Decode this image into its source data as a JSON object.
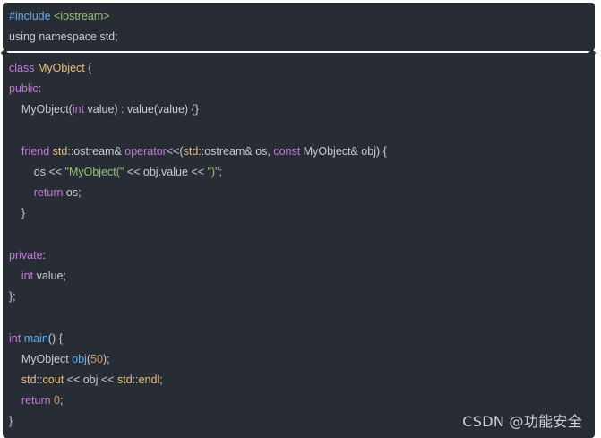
{
  "colors": {
    "background": "#282c34",
    "text": "#c7ccd6",
    "keyword": "#c678dd",
    "type": "#e5c07b",
    "function": "#61afef",
    "string": "#98c379",
    "number": "#d19a66"
  },
  "header_block": {
    "lines": [
      [
        {
          "t": "#include ",
          "c": "macro"
        },
        {
          "t": "<iostream>",
          "c": "str"
        }
      ],
      [
        {
          "t": "using namespace std;",
          "c": "txt"
        }
      ]
    ]
  },
  "code_block": {
    "lines": [
      [
        {
          "t": "class ",
          "c": "kw"
        },
        {
          "t": "MyObject",
          "c": "type"
        },
        {
          "t": " {",
          "c": "txt"
        }
      ],
      [
        {
          "t": "public",
          "c": "kw"
        },
        {
          "t": ":",
          "c": "txt"
        }
      ],
      [
        {
          "t": "    MyObject(",
          "c": "txt"
        },
        {
          "t": "int",
          "c": "kw"
        },
        {
          "t": " value) : value(value) {}",
          "c": "txt"
        }
      ],
      [],
      [
        {
          "t": "    ",
          "c": "txt"
        },
        {
          "t": "friend ",
          "c": "kw"
        },
        {
          "t": "std",
          "c": "type"
        },
        {
          "t": "::ostream& ",
          "c": "txt"
        },
        {
          "t": "operator",
          "c": "kw"
        },
        {
          "t": "<<(",
          "c": "txt"
        },
        {
          "t": "std",
          "c": "type"
        },
        {
          "t": "::ostream& os, ",
          "c": "txt"
        },
        {
          "t": "const",
          "c": "kw"
        },
        {
          "t": " MyObject& obj) {",
          "c": "txt"
        }
      ],
      [
        {
          "t": "        os << ",
          "c": "txt"
        },
        {
          "t": "\"MyObject(\"",
          "c": "str"
        },
        {
          "t": " << obj.value << ",
          "c": "txt"
        },
        {
          "t": "\")\"",
          "c": "str"
        },
        {
          "t": ";",
          "c": "txt"
        }
      ],
      [
        {
          "t": "        ",
          "c": "txt"
        },
        {
          "t": "return",
          "c": "kw"
        },
        {
          "t": " os;",
          "c": "txt"
        }
      ],
      [
        {
          "t": "    }",
          "c": "txt"
        }
      ],
      [],
      [
        {
          "t": "private",
          "c": "kw"
        },
        {
          "t": ":",
          "c": "txt"
        }
      ],
      [
        {
          "t": "    ",
          "c": "txt"
        },
        {
          "t": "int",
          "c": "kw"
        },
        {
          "t": " value;",
          "c": "txt"
        }
      ],
      [
        {
          "t": "};",
          "c": "txt"
        }
      ],
      [],
      [
        {
          "t": "int",
          "c": "kw"
        },
        {
          "t": " ",
          "c": "txt"
        },
        {
          "t": "main",
          "c": "fn"
        },
        {
          "t": "() {",
          "c": "txt"
        }
      ],
      [
        {
          "t": "    MyObject ",
          "c": "txt"
        },
        {
          "t": "obj",
          "c": "fn"
        },
        {
          "t": "(",
          "c": "txt"
        },
        {
          "t": "50",
          "c": "num"
        },
        {
          "t": ");",
          "c": "txt"
        }
      ],
      [
        {
          "t": "    ",
          "c": "txt"
        },
        {
          "t": "std",
          "c": "type"
        },
        {
          "t": "::",
          "c": "txt"
        },
        {
          "t": "cout",
          "c": "type"
        },
        {
          "t": " << obj << ",
          "c": "txt"
        },
        {
          "t": "std",
          "c": "type"
        },
        {
          "t": "::",
          "c": "txt"
        },
        {
          "t": "endl",
          "c": "type"
        },
        {
          "t": ";",
          "c": "txt"
        }
      ],
      [
        {
          "t": "    ",
          "c": "txt"
        },
        {
          "t": "return",
          "c": "kw"
        },
        {
          "t": " ",
          "c": "txt"
        },
        {
          "t": "0",
          "c": "num"
        },
        {
          "t": ";",
          "c": "txt"
        }
      ],
      [
        {
          "t": "}",
          "c": "txt"
        }
      ]
    ]
  },
  "watermark": "CSDN @功能安全"
}
